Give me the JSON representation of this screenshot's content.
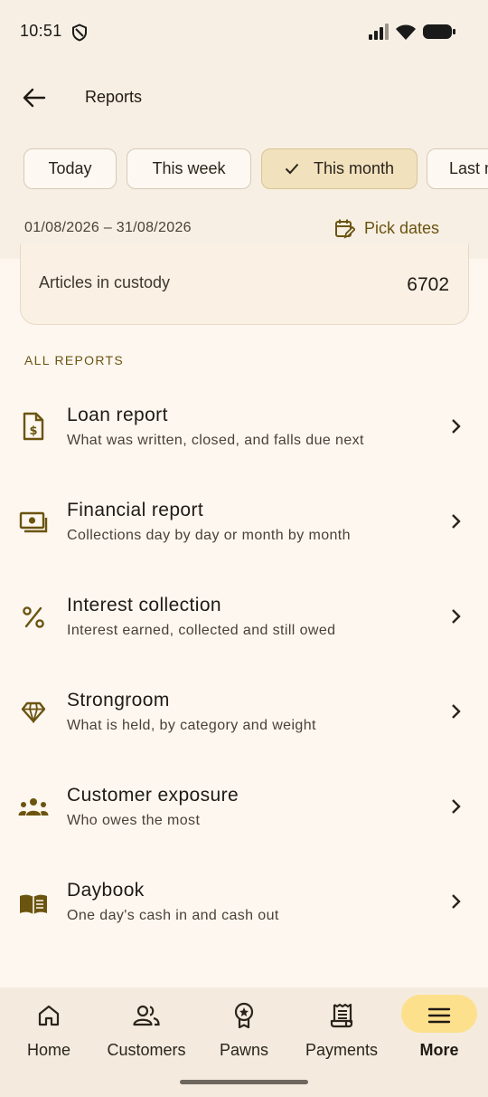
{
  "status_bar": {
    "time": "10:51"
  },
  "app_bar": {
    "title": "Reports"
  },
  "chips": [
    {
      "label": "Today",
      "selected": false
    },
    {
      "label": "This week",
      "selected": false
    },
    {
      "label": "This month",
      "selected": true
    },
    {
      "label": "Last m",
      "selected": false
    }
  ],
  "date_range": "01/08/2026 – 31/08/2026",
  "pick_dates_label": "Pick dates",
  "summary_card": {
    "label": "Articles in custody",
    "value": "6702"
  },
  "section_header": "ALL REPORTS",
  "reports": [
    {
      "title": "Loan report",
      "subtitle": "What was written, closed, and falls due next",
      "icon": "loan-document-icon"
    },
    {
      "title": "Financial report",
      "subtitle": "Collections day by day or month by month",
      "icon": "cash-icon"
    },
    {
      "title": "Interest collection",
      "subtitle": "Interest earned, collected and still owed",
      "icon": "percent-icon"
    },
    {
      "title": "Strongroom",
      "subtitle": "What is held, by category and weight",
      "icon": "diamond-icon"
    },
    {
      "title": "Customer exposure",
      "subtitle": "Who owes the most",
      "icon": "group-icon"
    },
    {
      "title": "Daybook",
      "subtitle": "One day's cash in and cash out",
      "icon": "book-icon"
    }
  ],
  "bottom_nav": [
    {
      "label": "Home",
      "icon": "home-icon",
      "active": false
    },
    {
      "label": "Customers",
      "icon": "customers-icon",
      "active": false
    },
    {
      "label": "Pawns",
      "icon": "pawn-badge-icon",
      "active": false
    },
    {
      "label": "Payments",
      "icon": "receipt-icon",
      "active": false
    },
    {
      "label": "More",
      "icon": "menu-icon",
      "active": true
    }
  ],
  "colors": {
    "accent": "#6b5410",
    "selected_chip": "#f1e1bd",
    "active_nav_pill": "#fde08c",
    "background": "#fdf7f0",
    "header_background": "#f7efe3"
  }
}
